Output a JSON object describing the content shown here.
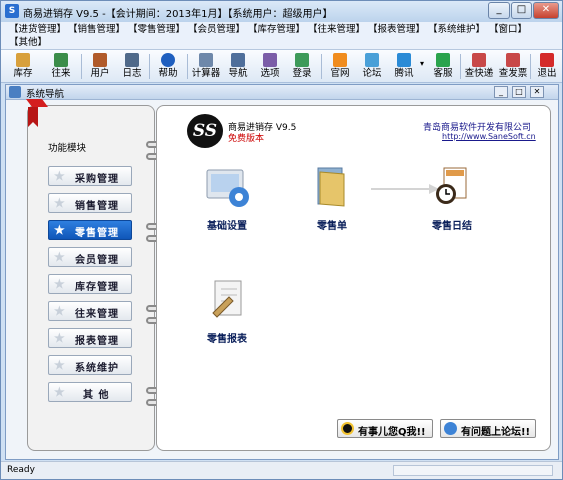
{
  "window": {
    "title": "商易进销存 V9.5 -【会计期间：2013年1月】【系统用户：超级用户】",
    "icon": "app-icon"
  },
  "menu": [
    "【进货管理】",
    "【销售管理】",
    "【零售管理】",
    "【会员管理】",
    "【库存管理】",
    "【往来管理】",
    "【报表管理】",
    "【系统维护】",
    "【窗口】",
    "【其他】"
  ],
  "toolbar": [
    "库存",
    "往来",
    "用户",
    "日志",
    "帮助",
    "计算器",
    "导航",
    "选项",
    "登录",
    "官网",
    "论坛",
    "腾讯",
    "客服",
    "查快递",
    "查发票",
    "退出"
  ],
  "nav_window": {
    "title": "系统导航"
  },
  "left": {
    "heading": "功能模块",
    "modules": [
      "采购管理",
      "销售管理",
      "零售管理",
      "会员管理",
      "库存管理",
      "往来管理",
      "报表管理",
      "系统维护",
      "其 他"
    ],
    "active_index": 2
  },
  "header": {
    "logo_text": "SS",
    "product": "商易进销存 V9.5",
    "edition": "免费版本",
    "company": "青岛商易软件开发有限公司",
    "url": "http://www.SaneSoft.cn"
  },
  "flow": {
    "basic": "基础设置",
    "retail_order": "零售单",
    "daily": "零售日结",
    "report": "零售报表"
  },
  "buttons": {
    "qq": "有事儿您Q我!!",
    "forum": "有问题上论坛!!"
  },
  "status": {
    "text": "Ready"
  },
  "colors": {
    "accent": "#1467cc",
    "edition": "#cc0000",
    "link": "#1a1a8c"
  }
}
